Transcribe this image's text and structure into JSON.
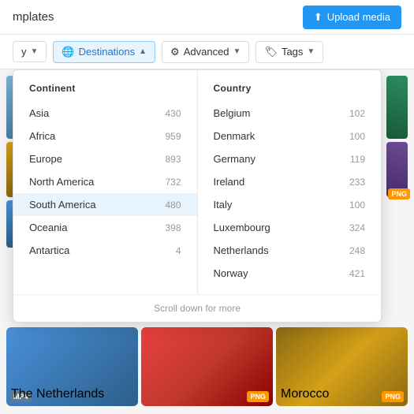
{
  "header": {
    "title": "mplates",
    "upload_label": "Upload media",
    "upload_icon": "upload-icon"
  },
  "filter_bar": {
    "buttons": [
      {
        "id": "type",
        "label": "y",
        "icon": "chevron-down-icon",
        "active": false
      },
      {
        "id": "destinations",
        "label": "Destinations",
        "icon": "globe-icon",
        "active": true
      },
      {
        "id": "advanced",
        "label": "Advanced",
        "icon": "sliders-icon",
        "active": false
      },
      {
        "id": "tags",
        "label": "Tags",
        "icon": "tag-icon",
        "active": false
      }
    ]
  },
  "dropdown": {
    "continent_header": "Continent",
    "country_header": "Country",
    "continents": [
      {
        "name": "Asia",
        "count": 430
      },
      {
        "name": "Africa",
        "count": 959
      },
      {
        "name": "Europe",
        "count": 893
      },
      {
        "name": "North America",
        "count": 732
      },
      {
        "name": "South America",
        "count": 480
      },
      {
        "name": "Oceania",
        "count": 398
      },
      {
        "name": "Antartica",
        "count": 4
      }
    ],
    "countries": [
      {
        "name": "Belgium",
        "count": 102
      },
      {
        "name": "Denmark",
        "count": 100
      },
      {
        "name": "Germany",
        "count": 119
      },
      {
        "name": "Ireland",
        "count": 233
      },
      {
        "name": "Italy",
        "count": 100
      },
      {
        "name": "Luxembourg",
        "count": 324
      },
      {
        "name": "Netherlands",
        "count": 248
      },
      {
        "name": "Norway",
        "count": 421
      }
    ],
    "scroll_hint": "Scroll down for more"
  },
  "thumbnails": [
    {
      "id": "thumb1",
      "label": "The Netherlands",
      "badge": "MP4",
      "badge_type": "mp4"
    },
    {
      "id": "thumb2",
      "label": "",
      "badge": "PNG",
      "badge_type": "png"
    },
    {
      "id": "thumb3",
      "label": "Morocco",
      "badge": "PNG",
      "badge_type": "png"
    }
  ],
  "colors": {
    "accent": "#2196F3",
    "selected_bg": "#e8f4fd",
    "border": "#e0e0e0"
  }
}
